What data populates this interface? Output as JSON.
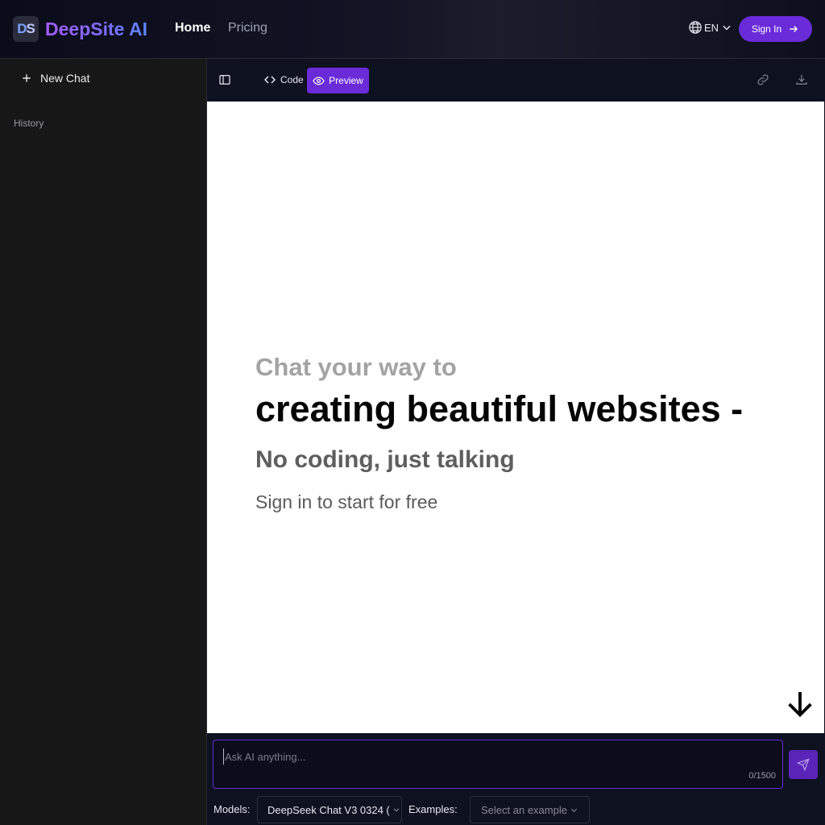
{
  "header": {
    "logo_letters_a": "D",
    "logo_letters_b": "S",
    "brand": "DeepSite AI",
    "nav_home": "Home",
    "nav_pricing": "Pricing",
    "language": "EN",
    "signin_label": "Sign In"
  },
  "sidebar": {
    "new_chat_label": "New Chat",
    "history_label": "History"
  },
  "toolbar": {
    "code_label": "Code",
    "preview_label": "Preview",
    "active_tab": "Preview"
  },
  "preview": {
    "line1": "Chat your way to",
    "line2": "creating beautiful websites -",
    "line3": "No coding, just talking",
    "line4": "Sign in to start for free"
  },
  "composer": {
    "placeholder": "Ask AI anything...",
    "value": "",
    "counter": "0/1500",
    "models_label": "Models:",
    "models_value": "DeepSeek Chat V3 0324 (",
    "examples_label": "Examples:",
    "examples_placeholder": "Select an example"
  },
  "colors": {
    "accent": "#6a2bd9",
    "sidebar_bg": "#171717",
    "app_bg": "#0e1120"
  },
  "icons": {
    "globe": "globe-icon",
    "chevron": "chevron-down-icon",
    "arrow_right": "arrow-right-icon",
    "plus": "plus-icon",
    "sidebar_toggle": "sidebar-toggle-icon",
    "code": "code-icon",
    "eye": "eye-icon",
    "link": "link-icon",
    "download": "download-icon",
    "arrow_down": "arrow-down-icon",
    "send": "send-icon"
  }
}
